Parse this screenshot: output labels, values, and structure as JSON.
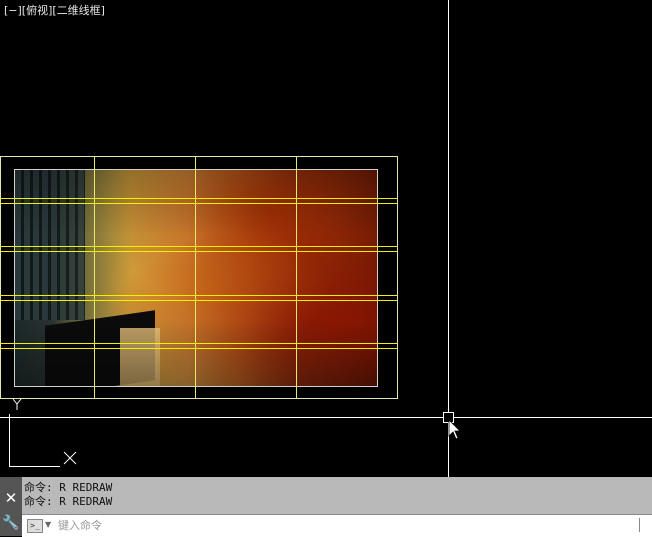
{
  "viewport": {
    "view_label": "[−][俯视][二维线框]",
    "ucs_y_axis": "Y",
    "ucs_x_axis": "X",
    "line_color": "#ffffff",
    "grid_color": "#f2f200",
    "frame_color": "#e6e6b0"
  },
  "command_line": {
    "history": [
      "命令: R REDRAW",
      "命令: R REDRAW"
    ],
    "placeholder": "键入命令",
    "close_icon": "close-icon",
    "settings_icon": "wrench-icon",
    "prompt_icon": "command-prompt-icon"
  },
  "colors": {
    "canvas_bg": "#000000",
    "panel_bg": "#b9b9b9",
    "panel_left_bg": "#555555"
  }
}
